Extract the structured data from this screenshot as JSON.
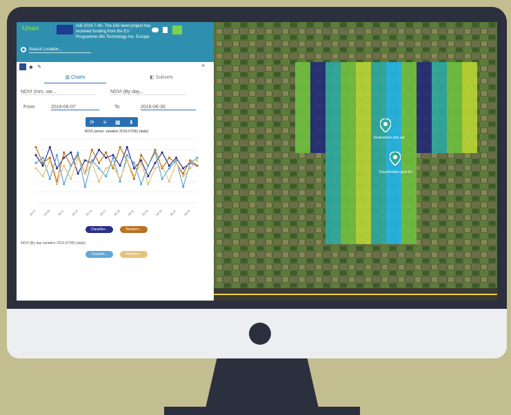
{
  "app": {
    "logo": "Unav",
    "banner_text": "iAB 2019-7-40. The DAI level project has received funding from the EU Programme dlin Technology Inc. Europe stern"
  },
  "search": {
    "placeholder": "Search Location..."
  },
  "panel": {
    "tabs": [
      {
        "label": "Charts"
      },
      {
        "label": "Subsets"
      }
    ],
    "series_select_left": "NDVI (mm, var...",
    "series_select_right": "NDVI (By day...",
    "from_label": "From",
    "from_value": "2016-06-07",
    "to_label": "To",
    "to_value": "2016-06-30",
    "chart_title": "NDVI (anom. variation 2019-07/06) (daily)",
    "legend_buttons": [
      {
        "label": "Classifier...",
        "color": "#2b2f8a"
      },
      {
        "label": "Random...",
        "color": "#b9731f"
      }
    ],
    "subtitle2": "NDVI (By day variation 2019-07/06) (daily)",
    "legend_buttons2": [
      {
        "label": "Classifie...",
        "color": "#5fa7d6"
      },
      {
        "label": "Random...",
        "color": "#e4c27a"
      }
    ]
  },
  "map": {
    "markers": [
      {
        "label": "Sivakastone p/la sat"
      },
      {
        "label": "Classification glad 5Lt"
      }
    ],
    "colors": {
      "teal": "#2ea9a0",
      "green": "#6fbf3f",
      "navy": "#232a75",
      "cyan": "#22b5e8",
      "lime": "#b8d534"
    }
  },
  "chart_data": {
    "type": "line",
    "title": "NDVI (anom. variation 2019-07/06) (daily)",
    "x": [
      "06-07",
      "06-08",
      "06-09",
      "06-10",
      "06-11",
      "06-12",
      "06-13",
      "06-14",
      "06-15",
      "06-16",
      "06-17",
      "06-18",
      "06-19",
      "06-20",
      "06-21",
      "06-22",
      "06-23",
      "06-24",
      "06-25",
      "06-26",
      "06-27",
      "06-28",
      "06-29",
      "06-30"
    ],
    "ylim": [
      -1.2,
      1.2
    ],
    "series": [
      {
        "values": [
          0.6,
          0.2,
          0.9,
          0.1,
          0.5,
          0.7,
          -0.1,
          0.4,
          0.3,
          0.8,
          0.5,
          0.6,
          0.2,
          0.9,
          0.1,
          0.4,
          -0.2,
          0.3,
          0.7,
          0.2,
          0.5,
          0.1,
          0.3,
          0.2
        ],
        "color": "#2b2f8a"
      },
      {
        "values": [
          0.9,
          0.3,
          0.5,
          -0.4,
          0.7,
          0.2,
          0.6,
          -0.1,
          0.8,
          0.3,
          0.7,
          0.1,
          0.9,
          0.4,
          -0.3,
          0.6,
          0.2,
          0.8,
          0.1,
          0.5,
          0.3,
          -0.1,
          0.4,
          0.2
        ],
        "color": "#b9731f"
      },
      {
        "values": [
          0.3,
          0.5,
          -0.3,
          0.6,
          -0.5,
          0.2,
          0.7,
          -0.6,
          0.4,
          0.1,
          -0.2,
          0.5,
          -0.4,
          0.6,
          0.3,
          -0.5,
          0.2,
          0.7,
          -0.3,
          0.1,
          0.4,
          -0.6,
          0.3,
          0.5
        ],
        "color": "#5fa7d6"
      },
      {
        "values": [
          0.1,
          -0.2,
          0.4,
          -0.5,
          0.2,
          -0.3,
          0.5,
          -0.1,
          0.3,
          -0.4,
          0.1,
          0.2,
          -0.3,
          0.4,
          -0.2,
          0.3,
          -0.5,
          0.1,
          0.2,
          -0.4,
          0.3,
          -0.2,
          0.1,
          0.4
        ],
        "color": "#e4c27a"
      }
    ]
  }
}
